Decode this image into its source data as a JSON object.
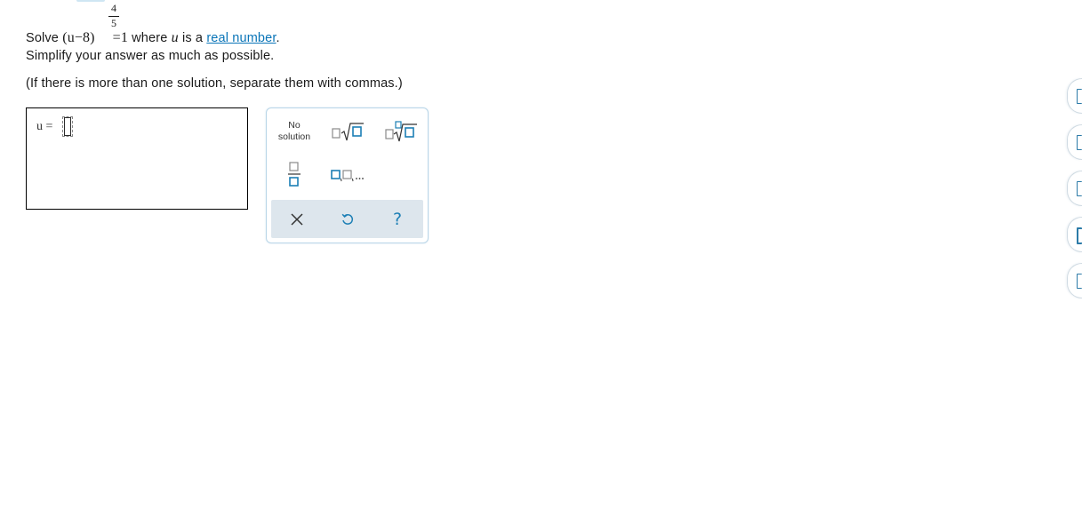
{
  "question": {
    "prefix": "Solve",
    "base_expr": "(u−8)",
    "exponent_num": "4",
    "exponent_den": "5",
    "rhs": "=1",
    "where_text": "where",
    "variable": "u",
    "is_a_text": "is a",
    "link_text": "real number",
    "period": ".",
    "line2": "Simplify your answer as much as possible.",
    "line3": "(If there is more than one solution, separate them with commas.)"
  },
  "answer": {
    "variable_label": "u =",
    "value": ""
  },
  "palette": {
    "no_solution_line1": "No",
    "no_solution_line2": "solution",
    "buttons": [
      "no-solution",
      "square-root",
      "nth-root",
      "fraction",
      "list",
      "clear",
      "undo",
      "help"
    ],
    "help_glyph": "?"
  },
  "side_tools": [
    "tool-1",
    "tool-2",
    "tool-3",
    "tool-4",
    "tool-5"
  ],
  "colors": {
    "link": "#0a75b8",
    "icon_teal": "#1c7fb5",
    "tray_bg": "#dde6ed",
    "palette_border": "#b9d6e8"
  }
}
